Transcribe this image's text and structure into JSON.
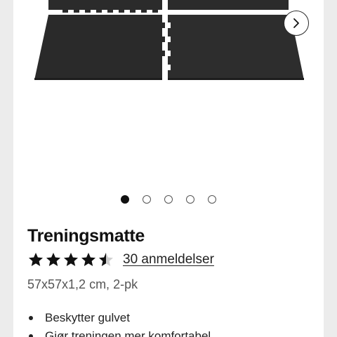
{
  "product": {
    "title": "Treningsmatte",
    "rating": 4.5,
    "rating_max": 5,
    "reviews_label": "30 anmeldelser",
    "subtitle": "57x57x1,2 cm, 2-pk",
    "features": [
      "Beskytter gulvet",
      "Gjør treningen mer komfortabel"
    ]
  },
  "gallery": {
    "image_count": 5,
    "active_index": 0,
    "next_icon": "chevron-right-icon"
  },
  "colors": {
    "mat": "#2b2b2b",
    "star": "#111111",
    "accent_text": "#222222"
  }
}
